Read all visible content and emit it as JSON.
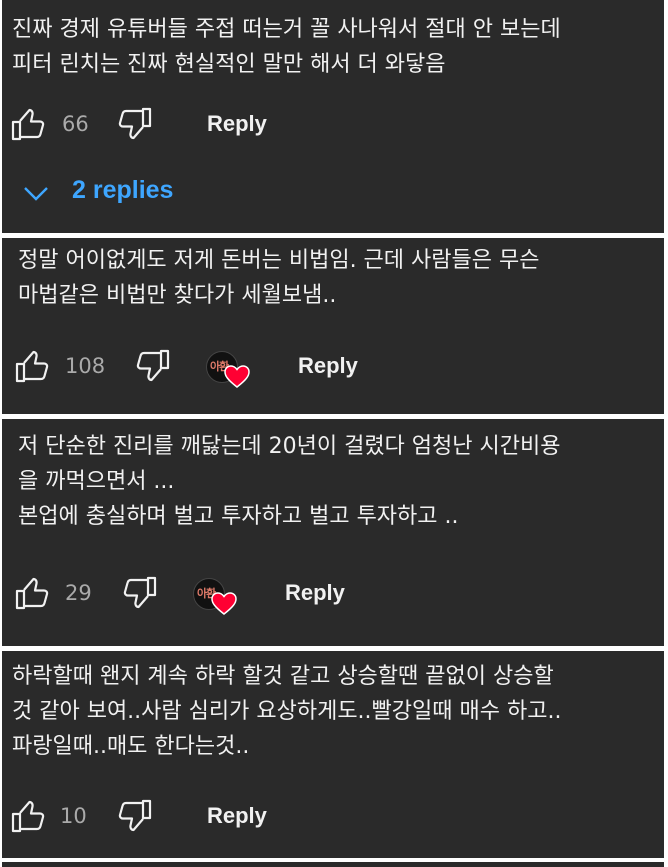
{
  "comments": [
    {
      "text": "진짜 경제 유튜버들 주접 떠는거 꼴 사나워서 절대 안 보는데\n피터 린치는 진짜 현실적인 말만 해서 더 와닿음",
      "likes": "66",
      "reply_label": "Reply",
      "replies_label": "2 replies",
      "creator_heart": false
    },
    {
      "text": "정말 어이없게도 저게 돈버는 비법임. 근데 사람들은 무슨\n마법같은 비법만 찾다가 세월보냄..",
      "likes": "108",
      "reply_label": "Reply",
      "creator_heart": true,
      "heart_avatar_text": "아환"
    },
    {
      "text": "저 단순한 진리를 깨닳는데 20년이 걸렸다 엄청난 시간비용\n을 까먹으면서 ...\n본업에 충실하며 벌고 투자하고 벌고 투자하고 ..",
      "likes": "29",
      "reply_label": "Reply",
      "creator_heart": true,
      "heart_avatar_text": "아환"
    },
    {
      "text": "하락할때 왠지 계속 하락 할것 같고 상승할땐 끝없이 상승할\n것 같아 보여..사람 심리가 요상하게도..빨강일때 매수 하고..\n파랑일때..매도 한다는것..",
      "likes": "10",
      "reply_label": "Reply",
      "creator_heart": false
    }
  ],
  "colors": {
    "card_bg": "#2a2a2a",
    "text": "#f1f1f1",
    "muted": "#aaaaaa",
    "link": "#3ea6ff",
    "heart": "#ff0033"
  },
  "icons": [
    "thumb-up-icon",
    "thumb-down-icon",
    "chevron-down-icon",
    "heart-icon"
  ]
}
